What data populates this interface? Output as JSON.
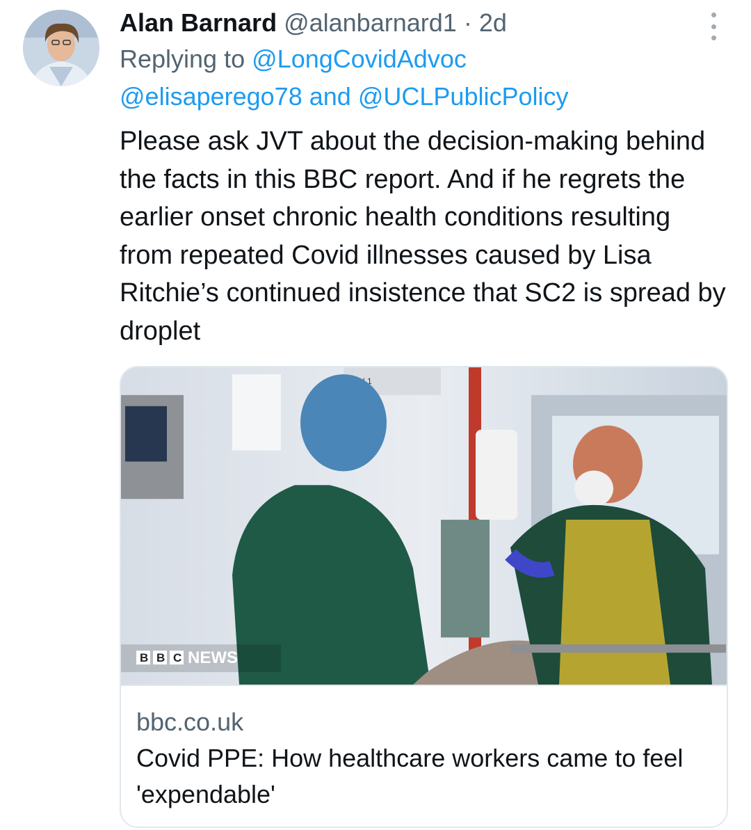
{
  "tweet": {
    "display_name": "Alan Barnard",
    "handle": "@alanbarnard1",
    "separator": "·",
    "time": "2d",
    "reply_prefix": "Replying to",
    "reply_mentions": [
      "@LongCovidAdvoc",
      "@elisaperego78",
      "@UCLPublicPolicy"
    ],
    "reply_and": "and",
    "text": "Please ask JVT about the decision-making behind the facts in this BBC report. And if he regrets the earlier onset chronic health conditions resulting from repeated Covid illnesses caused by Lisa Ritchie’s continued insistence that SC2 is spread by droplet",
    "more_icon": "more-vertical-icon",
    "avatar_icon": "user-avatar"
  },
  "card": {
    "image_watermark_logo": "BBC",
    "image_watermark_text": "NEWS",
    "image_sign_text": "ICU 1",
    "domain": "bbc.co.uk",
    "title": "Covid PPE: How healthcare workers came to feel 'expendable'"
  },
  "colors": {
    "link": "#1d9bf0",
    "secondary_text": "#536471",
    "primary_text": "#0f1419",
    "card_border": "#e1e8ed"
  }
}
